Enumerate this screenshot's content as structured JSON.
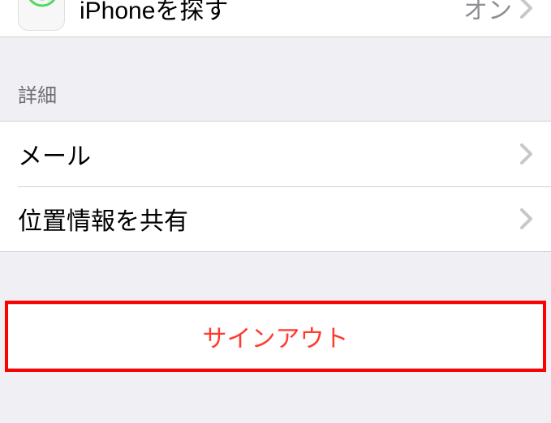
{
  "top": {
    "title": "iPhoneを探す",
    "value": "オン"
  },
  "details": {
    "header": "詳細",
    "items": [
      {
        "label": "メール"
      },
      {
        "label": "位置情報を共有"
      }
    ]
  },
  "signout": {
    "label": "サインアウト"
  },
  "colors": {
    "destructive": "#ff3b30",
    "highlight": "#ff0000",
    "background": "#efeff4",
    "separator": "#d1d1d5",
    "secondaryText": "#8e8e93"
  }
}
